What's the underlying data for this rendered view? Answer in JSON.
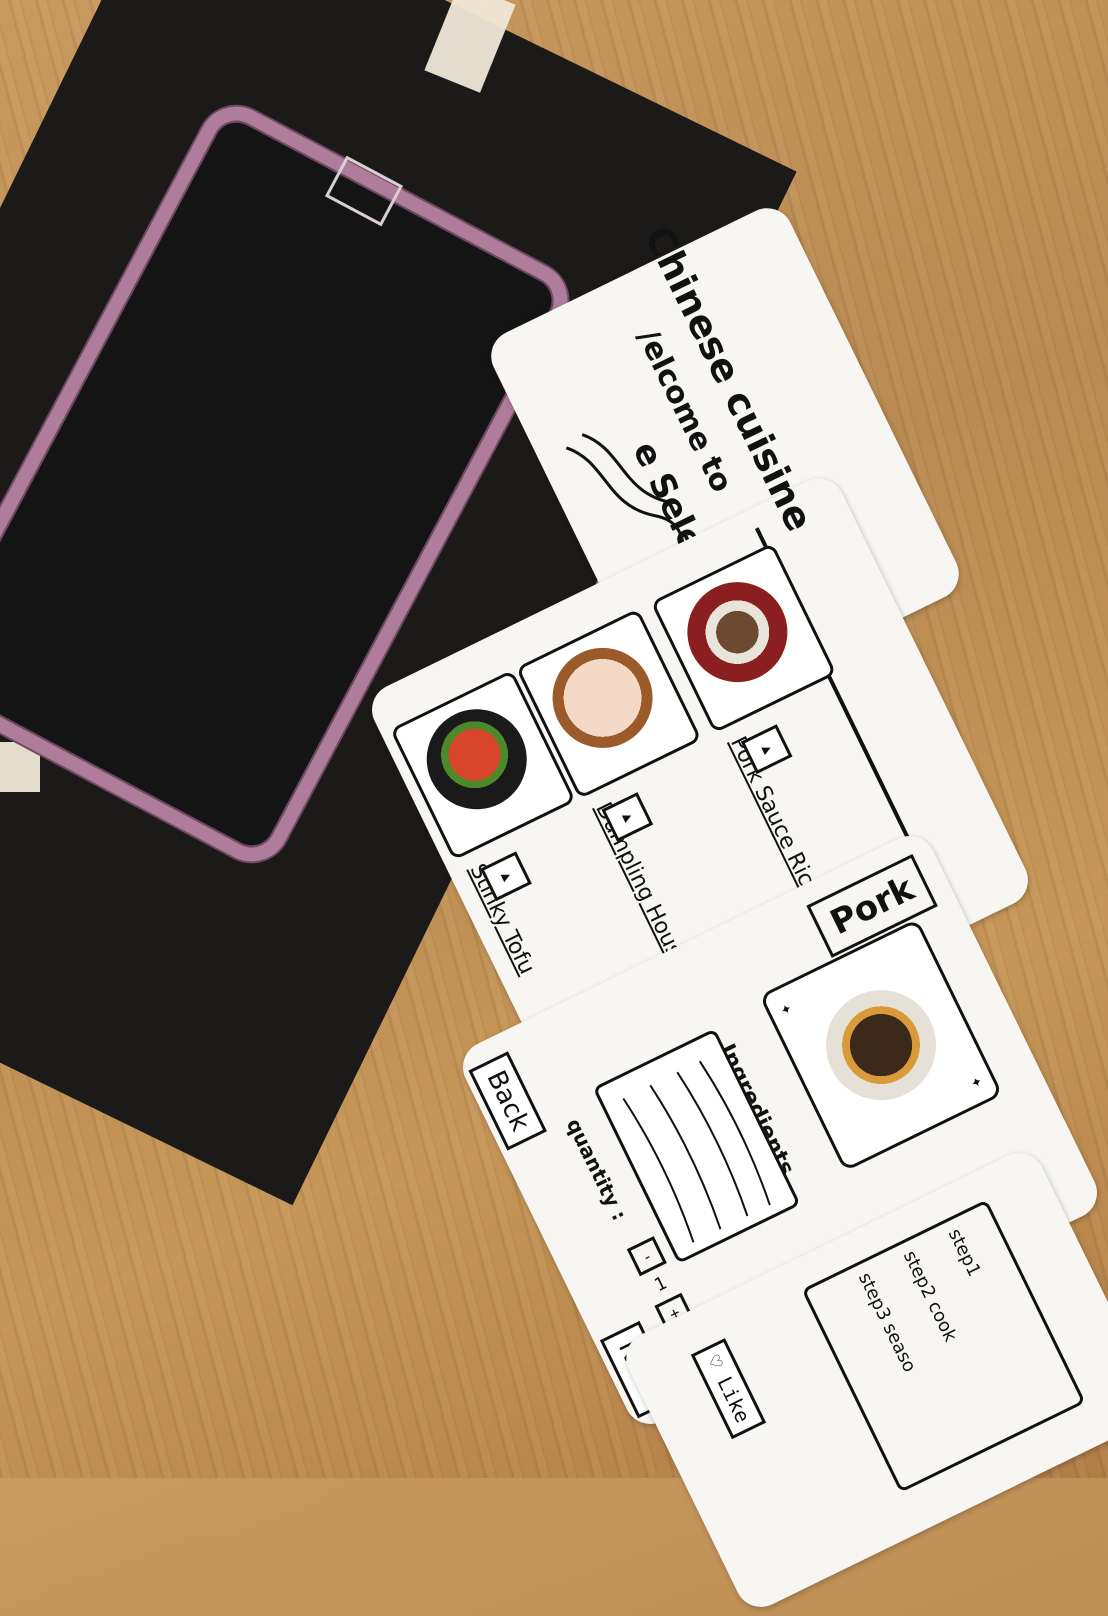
{
  "welcome": {
    "line1": "/elcome to",
    "line2": "e Selection"
  },
  "cuisine": {
    "title": "Chinese cuisine",
    "dishes": [
      {
        "name": "Pork Sauce Rice"
      },
      {
        "name": "Dumpling House"
      },
      {
        "name": "Stinky Tofu"
      }
    ]
  },
  "detail": {
    "title": "Pork",
    "ingredients_label": "Ingredients",
    "quantity_label": "quantity :",
    "quantity_value": "1",
    "minus_label": "-",
    "plus_label": "+",
    "back_label": "Back",
    "next_label": "Next"
  },
  "steps": {
    "step1": "step1",
    "step2": "step2 cook",
    "step3": "step3 seaso",
    "like_label": "Like"
  },
  "colors": {
    "table": "#c18f55",
    "board": "#1b1a19",
    "phone_outline": "#b07c9c",
    "paper": "#f7f6f2"
  }
}
